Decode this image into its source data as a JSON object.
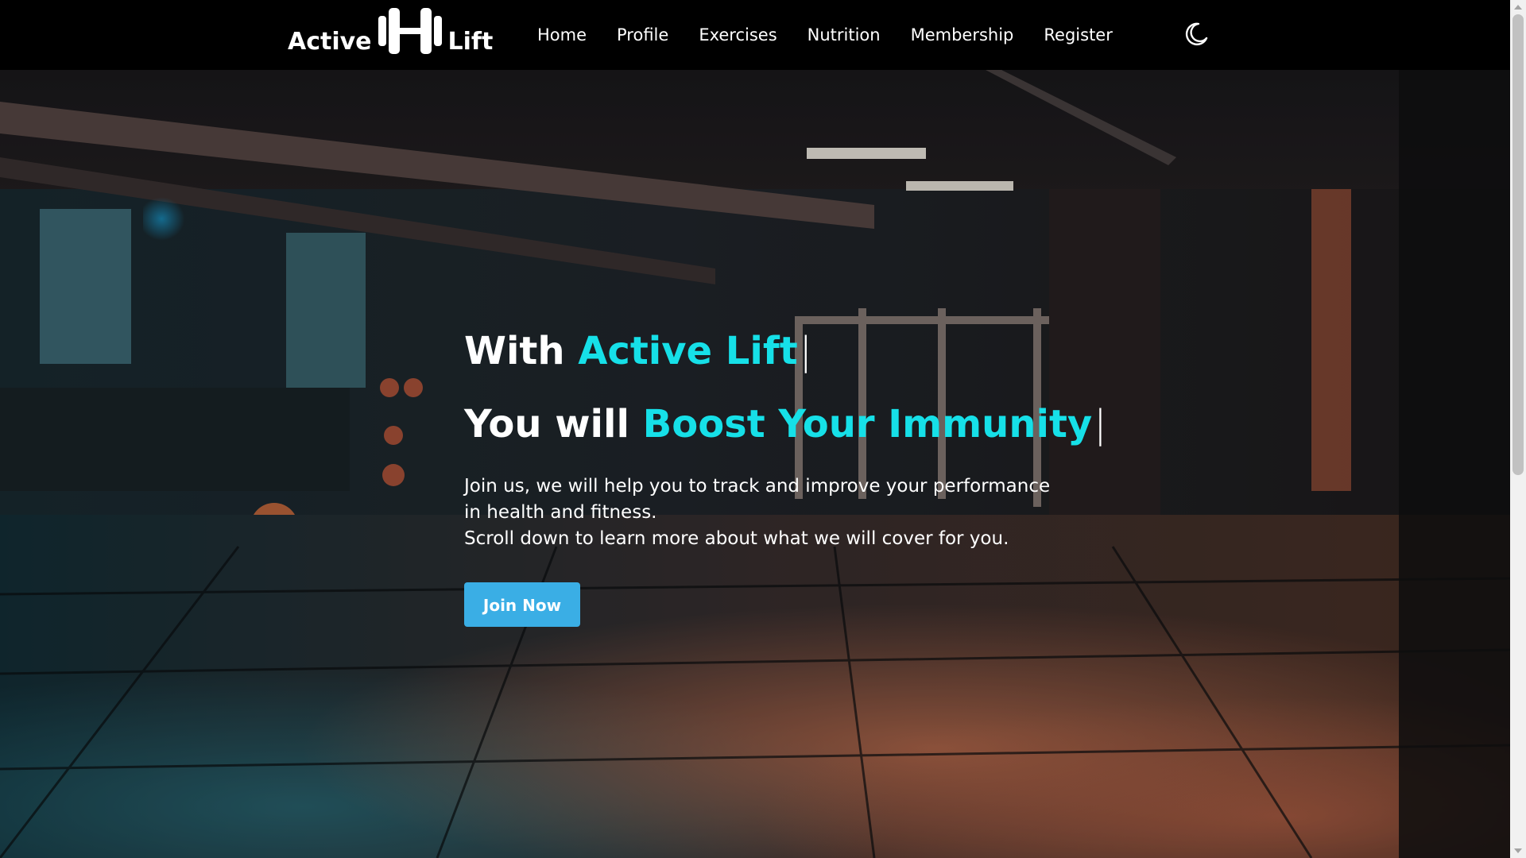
{
  "brand": {
    "word_left": "Active",
    "word_right": "Lift",
    "icon": "dumbbell-icon"
  },
  "nav": {
    "items": [
      {
        "label": "Home"
      },
      {
        "label": "Profile"
      },
      {
        "label": "Exercises"
      },
      {
        "label": "Nutrition"
      },
      {
        "label": "Membership"
      },
      {
        "label": "Register"
      }
    ],
    "theme_toggle_icon": "moon-icon"
  },
  "hero": {
    "line1_prefix": "With ",
    "line1_accent": "Active Lift",
    "line2_prefix": "You will ",
    "line2_accent": "Boost Your Immunity",
    "caret": "|",
    "description_line1": "Join us, we will help you to track and improve your performance in health and fitness.",
    "description_line2": "Scroll down to learn more about what we will cover for you.",
    "cta_label": "Join Now",
    "background": "gym-interior-photo"
  },
  "colors": {
    "accent": "#16e0e8",
    "button": "#3aaee5",
    "navbar": "#000000"
  }
}
